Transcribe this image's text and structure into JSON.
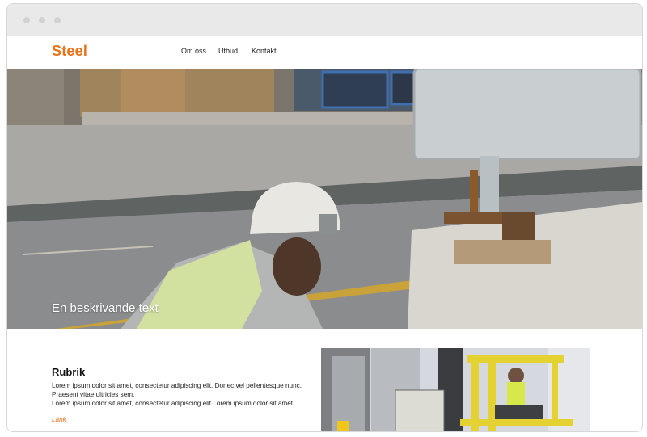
{
  "site": {
    "logo": "Steel"
  },
  "nav": {
    "items": [
      "Om oss",
      "Utbud",
      "Kontakt"
    ]
  },
  "hero": {
    "caption": "En beskrivande text"
  },
  "section": {
    "heading": "Rubrik",
    "body_line1": "Lorem ipsum dolor sit amet, consectetur adipiscing elit. Donec vel pellentesque nunc. Praesent vitae ultricies sem.",
    "body_line2": "Lorem ipsum dolor sit amet, consectetur adipiscing elit Lorem ipsum dolor sit amet.",
    "link": "Länk"
  },
  "colors": {
    "accent": "#e8741b",
    "chrome": "#e9e9e9"
  }
}
